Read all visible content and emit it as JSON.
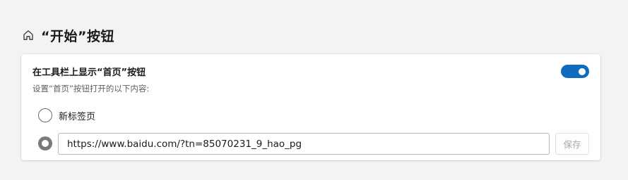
{
  "section": {
    "icon": "home-icon",
    "title": "“开始”按钮"
  },
  "setting": {
    "title": "在工具栏上显示“首页”按钮",
    "description": "设置“首页”按钮打开的以下内容:",
    "toggle_on": true,
    "accent_color": "#0f6cbd"
  },
  "options": {
    "new_tab_label": "新标签页",
    "new_tab_selected": false,
    "url_selected": true
  },
  "url_field": {
    "value": "https://www.baidu.com/?tn=85070231_9_hao_pg"
  },
  "save_button": {
    "label": "保存",
    "disabled": true
  }
}
